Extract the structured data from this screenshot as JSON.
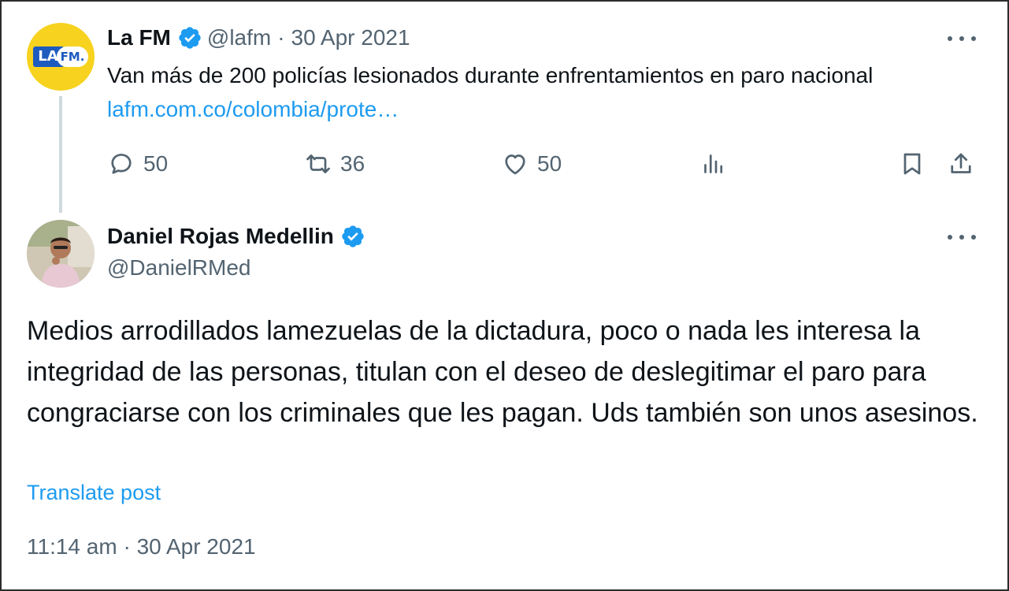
{
  "parent_tweet": {
    "avatar": {
      "logo_left": "LA",
      "logo_right": "FM.",
      "bg_color": "#f7d21e",
      "brand_color": "#1d5bbf"
    },
    "display_name": "La FM",
    "handle": "@lafm",
    "separator": "·",
    "date": "30 Apr 2021",
    "text": "Van más de 200 policías lesionados durante enfrentamientos en paro nacional ",
    "link_text": "lafm.com.co/colombia/prote…",
    "actions": {
      "reply": {
        "icon": "reply-icon",
        "count": "50"
      },
      "retweet": {
        "icon": "retweet-icon",
        "count": "36"
      },
      "like": {
        "icon": "like-icon",
        "count": "50"
      },
      "views": {
        "icon": "views-icon"
      },
      "bookmark": {
        "icon": "bookmark-icon"
      },
      "share": {
        "icon": "share-icon"
      }
    }
  },
  "reply_tweet": {
    "display_name": "Daniel Rojas Medellin",
    "handle": "@DanielRMed",
    "text": "Medios arrodillados lamezuelas de la dictadura, poco o nada les interesa la integridad de las personas, titulan con el deseo de deslegitimar el paro para congraciarse con los criminales que les pagan. Uds también son unos asesinos.",
    "translate_label": "Translate post",
    "timestamp_time": "11:14 am",
    "timestamp_sep": "·",
    "timestamp_date": "30 Apr 2021"
  },
  "colors": {
    "accent": "#1d9bf0",
    "secondary_text": "#536471",
    "primary_text": "#0f1419",
    "thread_line": "#cfd9de"
  }
}
